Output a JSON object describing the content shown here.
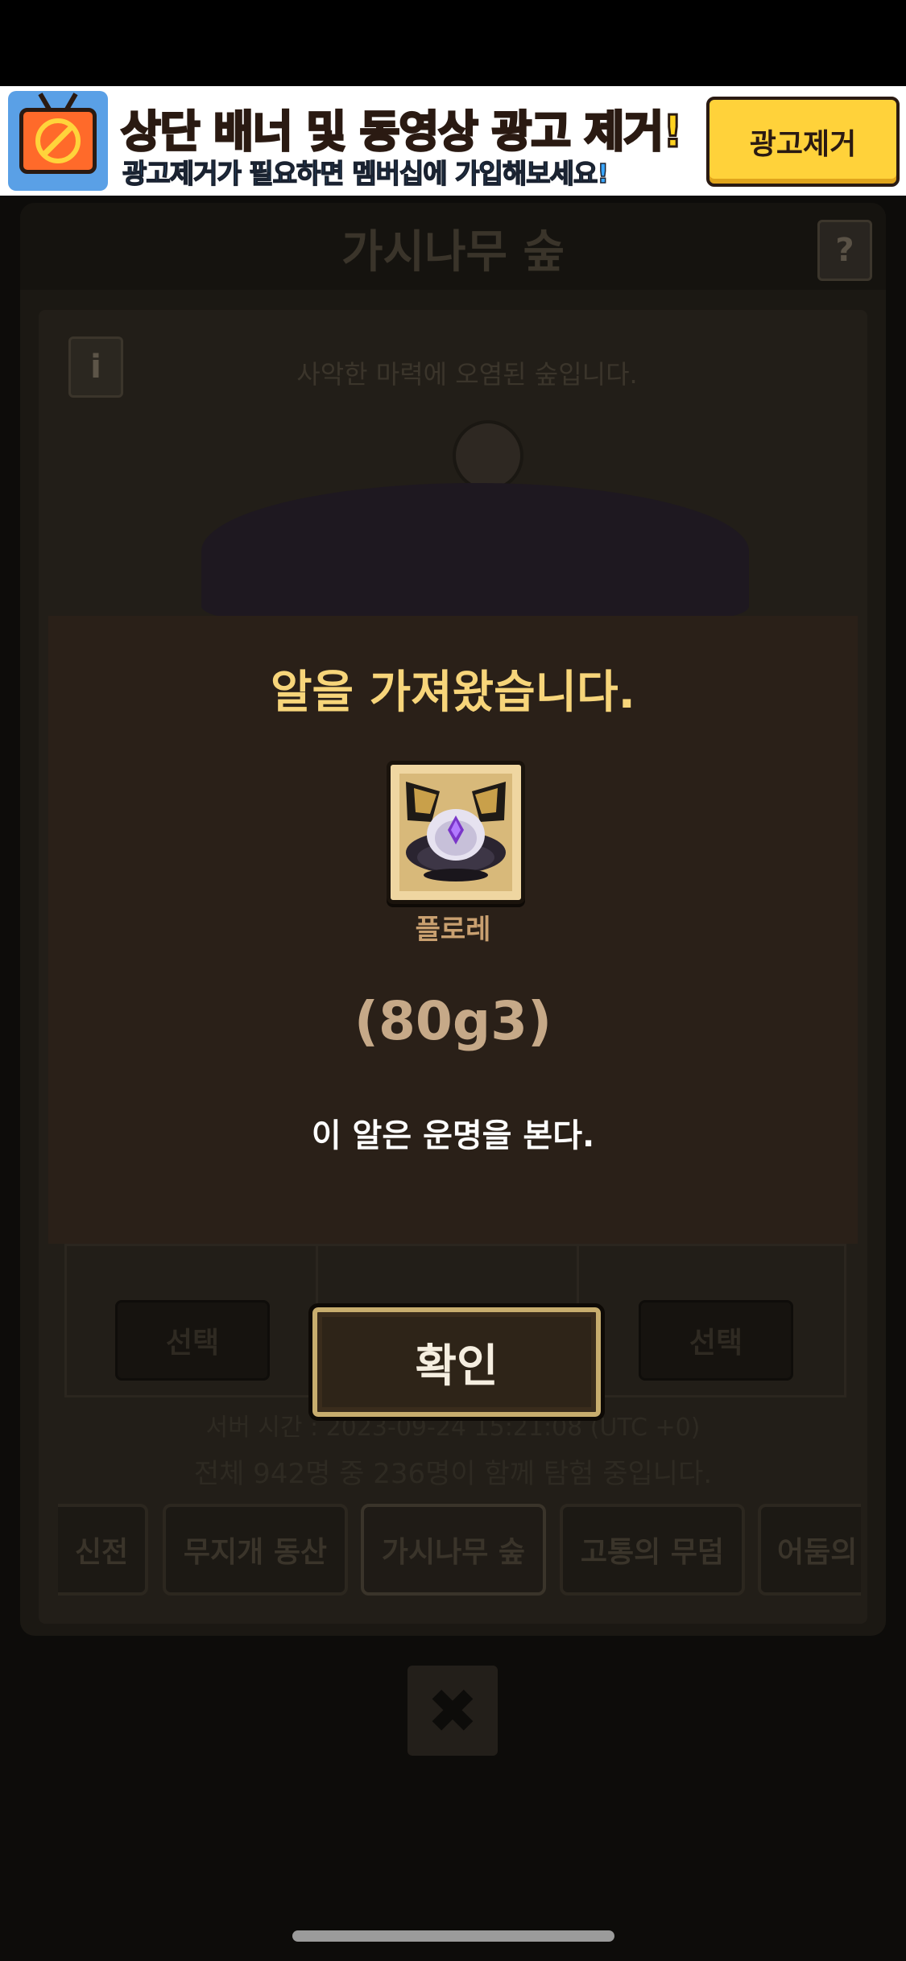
{
  "ad": {
    "title": "상단 배너 및 동영상 광고 제거!",
    "subtitle": "광고제거가 필요하면 멤버십에 가입해보세요!",
    "button": "광고제거",
    "icon": "no-ads-tv-icon"
  },
  "background": {
    "title": "가시나무 숲",
    "help_icon": "?",
    "info_icon": "i",
    "description": "사악한 마력에 오염된 숲입니다.",
    "slot_buttons": [
      "선택",
      "선택"
    ],
    "server_time": "서버 시간 : 2023-09-24 15:21:08 (UTC +0)",
    "player_count": "전체 942명 중 236명이 함께 탐험 중입니다.",
    "tabs": [
      "신전",
      "무지개 동산",
      "가시나무 숲",
      "고통의 무덤",
      "어둠의"
    ],
    "close_icon": "✖"
  },
  "modal": {
    "heading": "알을 가져왔습니다.",
    "egg_name": "플로레",
    "egg_code": "(80g3)",
    "egg_description": "이 알은 운명을 본다."
  },
  "confirm_button": "확인",
  "colors": {
    "accent_gold": "#f7d57a",
    "modal_bg": "#2a2018",
    "ad_yellow": "#ffd21f",
    "ad_blue": "#3aa6ff"
  }
}
